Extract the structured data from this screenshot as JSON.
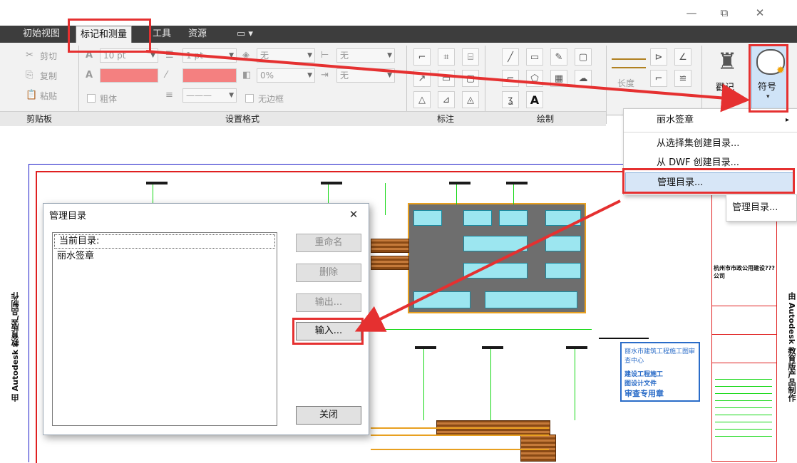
{
  "window": {
    "minimize": "—",
    "restore": "⧉",
    "close": "✕"
  },
  "tabs": [
    {
      "label": "初始视图"
    },
    {
      "label": "标记和测量",
      "active": true
    },
    {
      "label": "工具"
    },
    {
      "label": "资源"
    },
    {
      "label": "▭ ▾"
    }
  ],
  "ribbon": {
    "clipboard": {
      "cut": "剪切",
      "copy": "复制",
      "paste": "粘贴",
      "title": "剪贴板"
    },
    "format": {
      "font_size": "10 pt",
      "line_width": "1 pt",
      "fill": "无",
      "transparency": "0%",
      "line_style": "———",
      "start_arrow": "无",
      "end_arrow": "无",
      "bold": "粗体",
      "no_border": "无边框",
      "title": "设置格式"
    },
    "annotate": {
      "title": "标注"
    },
    "draw": {
      "title": "绘制"
    },
    "measure": {
      "length": "长度"
    },
    "stamp": "戳记",
    "symbol": "符号",
    "symbol_arrow": "▾"
  },
  "menu": {
    "items": [
      {
        "label": "丽水签章",
        "submenu": "▸"
      },
      {
        "label": "从选择集创建目录..."
      },
      {
        "label": "从 DWF 创建目录..."
      },
      {
        "label": "管理目录...",
        "highlighted": true
      }
    ]
  },
  "tooltip": "管理目录...",
  "dialog": {
    "title": "管理目录",
    "close": "✕",
    "list_header": "当前目录:",
    "list_items": [
      "丽水签章"
    ],
    "buttons": {
      "rename": "重命名",
      "delete": "删除",
      "export": "输出...",
      "import": "输入...",
      "close": "关闭"
    }
  },
  "drawing": {
    "watermark_left": "由 Autodesk 教育版产品制作",
    "watermark_right": "由 Autodesk 教育版产品制作",
    "company": "杭州市市政公用建设???公司",
    "project": "丽水市建筑工程施工图审查中心",
    "stamp_line1": "建设工程施工",
    "stamp_line2": "图设计文件",
    "stamp_line3": "审查专用章"
  },
  "colors": {
    "accent": "#e53030",
    "tab_bg": "#3d3d3d",
    "ribbon_bg": "#f2f2f2",
    "highlight": "#d7e6f7"
  }
}
